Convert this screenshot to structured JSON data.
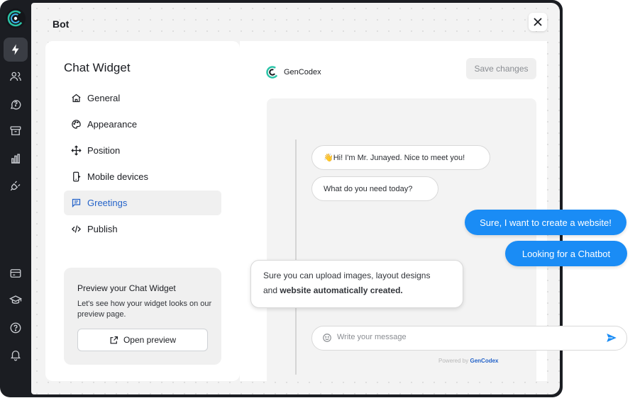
{
  "app": {
    "title": "Bot",
    "brand_colors": {
      "accent": "#1a8cf5",
      "link": "#2463c9",
      "rail": "#1b1d22"
    }
  },
  "rail": {
    "items": [
      {
        "icon": "lightning-icon",
        "active": true
      },
      {
        "icon": "users-icon"
      },
      {
        "icon": "chat-help-icon"
      },
      {
        "icon": "archive-icon"
      },
      {
        "icon": "bar-chart-icon"
      },
      {
        "icon": "plug-icon"
      },
      {
        "icon": "card-icon"
      },
      {
        "icon": "graduation-cap-icon"
      },
      {
        "icon": "help-circle-icon"
      },
      {
        "icon": "bell-icon"
      }
    ]
  },
  "panel": {
    "title": "Chat Widget",
    "menu": [
      {
        "label": "General",
        "icon": "home-icon"
      },
      {
        "label": "Appearance",
        "icon": "palette-icon"
      },
      {
        "label": "Position",
        "icon": "move-icon"
      },
      {
        "label": "Mobile devices",
        "icon": "mobile-icon"
      },
      {
        "label": "Greetings",
        "icon": "message-icon",
        "active": true
      },
      {
        "label": "Publish",
        "icon": "code-icon"
      }
    ],
    "preview_card": {
      "title": "Preview your Chat Widget",
      "text": "Let's see how your widget looks on our preview page.",
      "button": "Open preview"
    }
  },
  "preview": {
    "brand": "GenCodex",
    "save_label": "Save changes",
    "greetings": [
      "👋Hi! I'm Mr. Junayed. Nice to meet you!",
      "What do you need today?"
    ],
    "composer_placeholder": "Write your message",
    "powered_prefix": "Powered by",
    "powered_brand": "GenCodex"
  },
  "overlay": {
    "user_messages": [
      "Sure, I want to create a website!",
      "Looking for a Chatbot"
    ],
    "reply_line1": "Sure you can upload images, layout designs",
    "reply_line2_plain": "and ",
    "reply_line2_bold": "website automatically created."
  }
}
